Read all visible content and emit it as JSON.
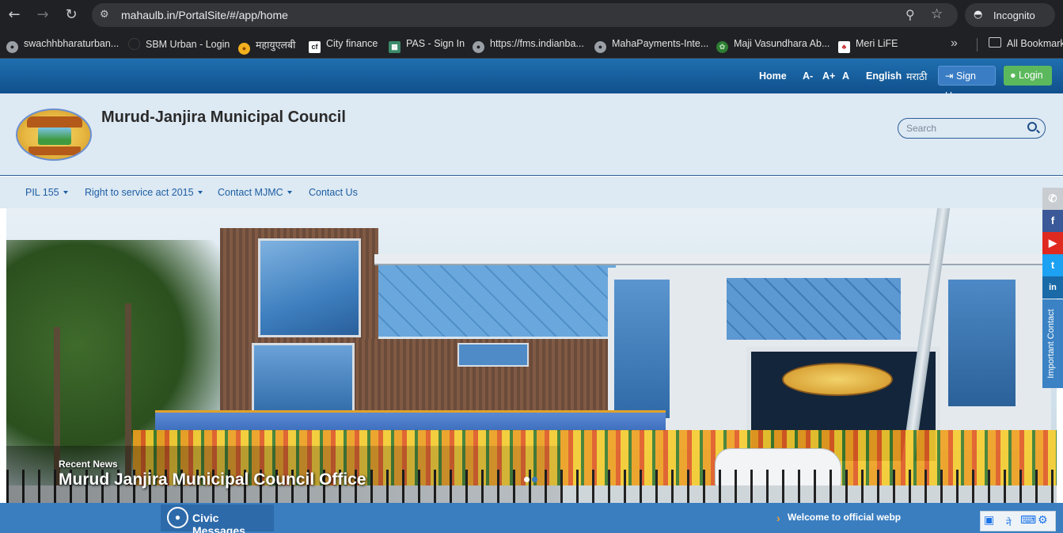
{
  "browser": {
    "url": "mahaulb.in/PortalSite/#/app/home",
    "incognito_label": "Incognito",
    "bookmarks": [
      "swachhbharaturban...",
      "SBM Urban - Login",
      "महायुएलबी",
      "City finance",
      "PAS - Sign In",
      "https://fms.indianba...",
      "MahaPayments-Inte...",
      "Maji Vasundhara Ab...",
      "Meri LiFE"
    ],
    "all_bookmarks": "All Bookmark"
  },
  "topbar": {
    "home": "Home",
    "font_decrease": "A-",
    "font_increase": "A+",
    "font_normal": "A",
    "lang_english": "English",
    "lang_marathi": "मराठी",
    "signup": "Sign Up",
    "login": "Login"
  },
  "header": {
    "title": "Murud-Janjira Municipal Council",
    "search_placeholder": "Search"
  },
  "menu": [
    {
      "label": "PIL 155",
      "dropdown": true
    },
    {
      "label": "Right to service act 2015",
      "dropdown": true
    },
    {
      "label": "Contact MJMC",
      "dropdown": true
    },
    {
      "label": "Contact Us",
      "dropdown": false
    }
  ],
  "hero": {
    "label": "Recent News",
    "title": "Murud Janjira Municipal Council Office",
    "slide_count": 2,
    "active_slide": 1
  },
  "sidebar": {
    "important_contact": "Important Contact",
    "social": [
      "phone",
      "facebook",
      "youtube",
      "twitter",
      "linkedin"
    ]
  },
  "footer": {
    "civic_messages": "Civic Messages",
    "ticker": "Welcome to official webpage"
  },
  "colors": {
    "topbar": "#10508c",
    "header_bg": "#dde9f3",
    "menu_link": "#1d5ea3",
    "login_green": "#5cb85c",
    "footer_bar": "#3a7ec0"
  }
}
